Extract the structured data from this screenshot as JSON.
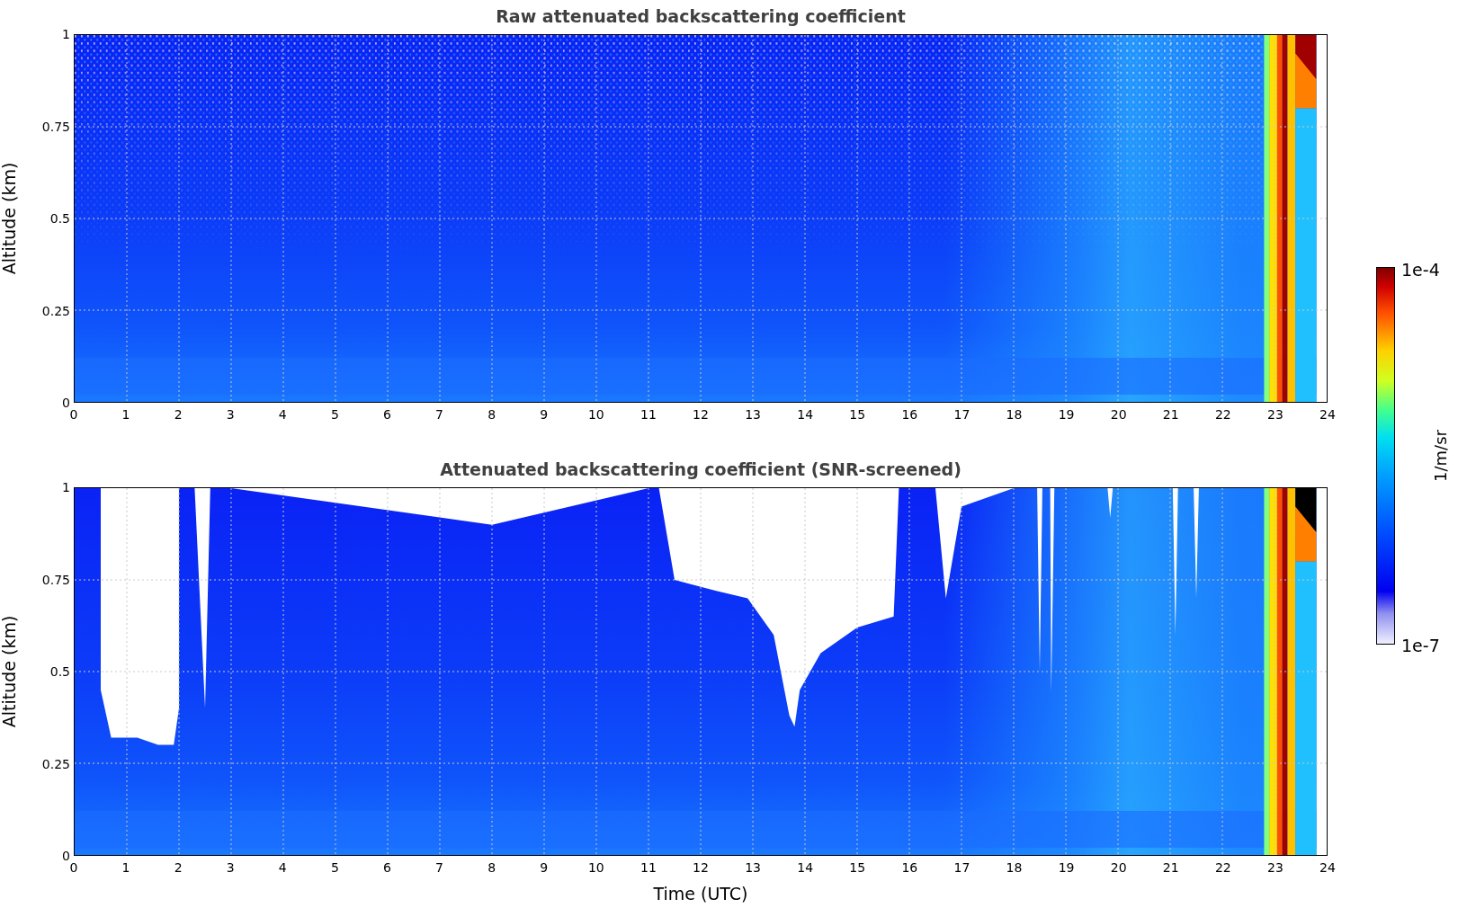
{
  "panels": [
    {
      "title": "Raw attenuated backscattering coefficient",
      "y_label": "Altitude (km)",
      "y_ticks": [
        "1",
        "0.75",
        "0.5",
        "0.25",
        "0"
      ],
      "x_ticks": [
        "0",
        "1",
        "2",
        "3",
        "4",
        "5",
        "6",
        "7",
        "8",
        "9",
        "10",
        "11",
        "12",
        "13",
        "14",
        "15",
        "16",
        "17",
        "18",
        "19",
        "20",
        "21",
        "22",
        "23",
        "24"
      ],
      "kind": "raw"
    },
    {
      "title": "Attenuated backscattering coefficient (SNR-screened)",
      "y_label": "Altitude (km)",
      "y_ticks": [
        "1",
        "0.75",
        "0.5",
        "0.25",
        "0"
      ],
      "x_ticks": [
        "0",
        "1",
        "2",
        "3",
        "4",
        "5",
        "6",
        "7",
        "8",
        "9",
        "10",
        "11",
        "12",
        "13",
        "14",
        "15",
        "16",
        "17",
        "18",
        "19",
        "20",
        "21",
        "22",
        "23",
        "24"
      ],
      "kind": "screened"
    }
  ],
  "x_label": "Time (UTC)",
  "colorbar": {
    "max_label": "1e-4",
    "min_label": "1e-7",
    "unit": "1/m/sr"
  }
}
